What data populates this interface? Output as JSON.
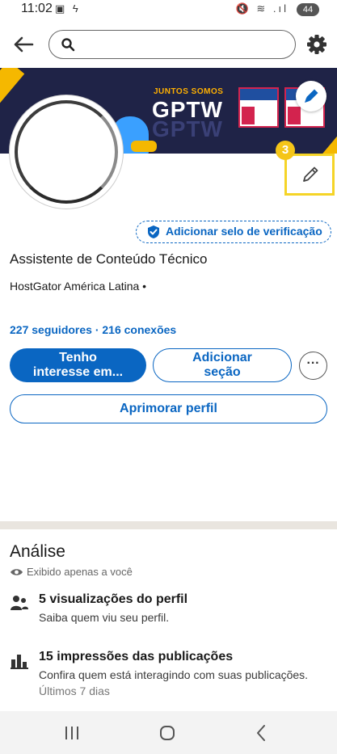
{
  "status_bar": {
    "time": "11:02",
    "left_icons": "▣ ϟ",
    "right_icons": "🔇 ≋ .ıl",
    "battery": "44"
  },
  "top_bar": {
    "search_placeholder": "",
    "back_icon": "arrow-left",
    "settings_icon": "gear"
  },
  "banner": {
    "small_text": "JUNTOS SOMOS",
    "big_text": "GPTW",
    "brand_colors": {
      "navy": "#1f2347",
      "yellow": "#f5b800",
      "red": "#d3234e"
    }
  },
  "annotation": {
    "step_number": "3"
  },
  "profile": {
    "verify_label": "Adicionar selo de verificação",
    "name": "Assistente de Conteúdo Técnico",
    "company": "HostGator América Latina •",
    "connections": "227 seguidores · 216 conexões"
  },
  "actions": {
    "primary_line1": "Tenho",
    "primary_line2": "interesse em...",
    "add_line1": "Adicionar",
    "add_line2": "seção",
    "more_label": "···",
    "improve_label": "Aprimorar perfil"
  },
  "analytics": {
    "title": "Análise",
    "private_note": "Exibido apenas a você",
    "items": [
      {
        "title": "5 visualizações do perfil",
        "subtitle": "Saiba quem viu seu perfil.",
        "extra": "",
        "icon": "people-icon"
      },
      {
        "title": "15 impressões das publicações",
        "subtitle": "Confira quem está interagindo com suas publicações.",
        "extra": "Últimos 7 dias",
        "icon": "bar-chart-icon"
      }
    ]
  },
  "colors": {
    "accent": "#0a66c2",
    "highlight": "#f5d427"
  }
}
